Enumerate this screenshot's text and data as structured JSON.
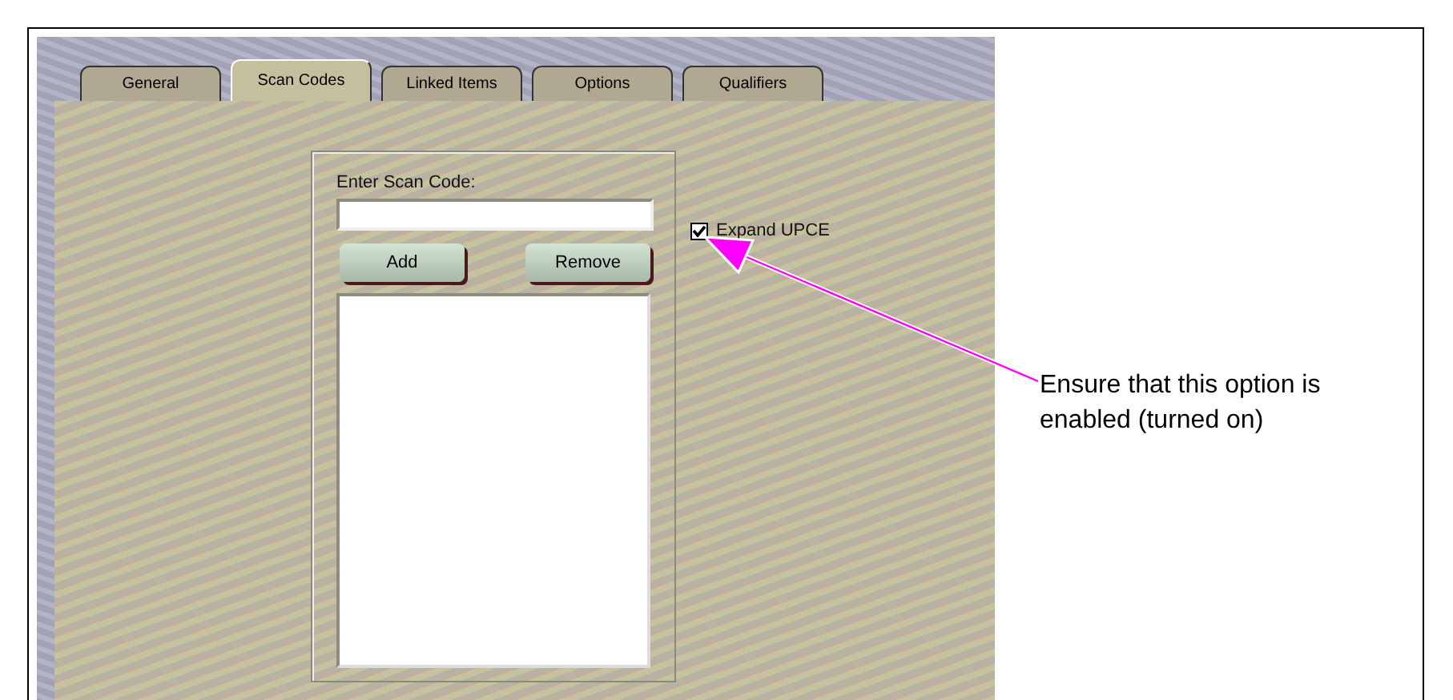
{
  "tabs": [
    {
      "label": "General",
      "selected": false
    },
    {
      "label": "Scan Codes",
      "selected": true
    },
    {
      "label": "Linked Items",
      "selected": false
    },
    {
      "label": "Options",
      "selected": false
    },
    {
      "label": "Qualifiers",
      "selected": false
    }
  ],
  "scan_code": {
    "label": "Enter Scan Code:"
  },
  "buttons": [
    "Add",
    "Remove"
  ],
  "expand_upce": {
    "label": "Expand UPCE",
    "checked": true
  },
  "callout": "Ensure that this option is enabled (turned on)"
}
